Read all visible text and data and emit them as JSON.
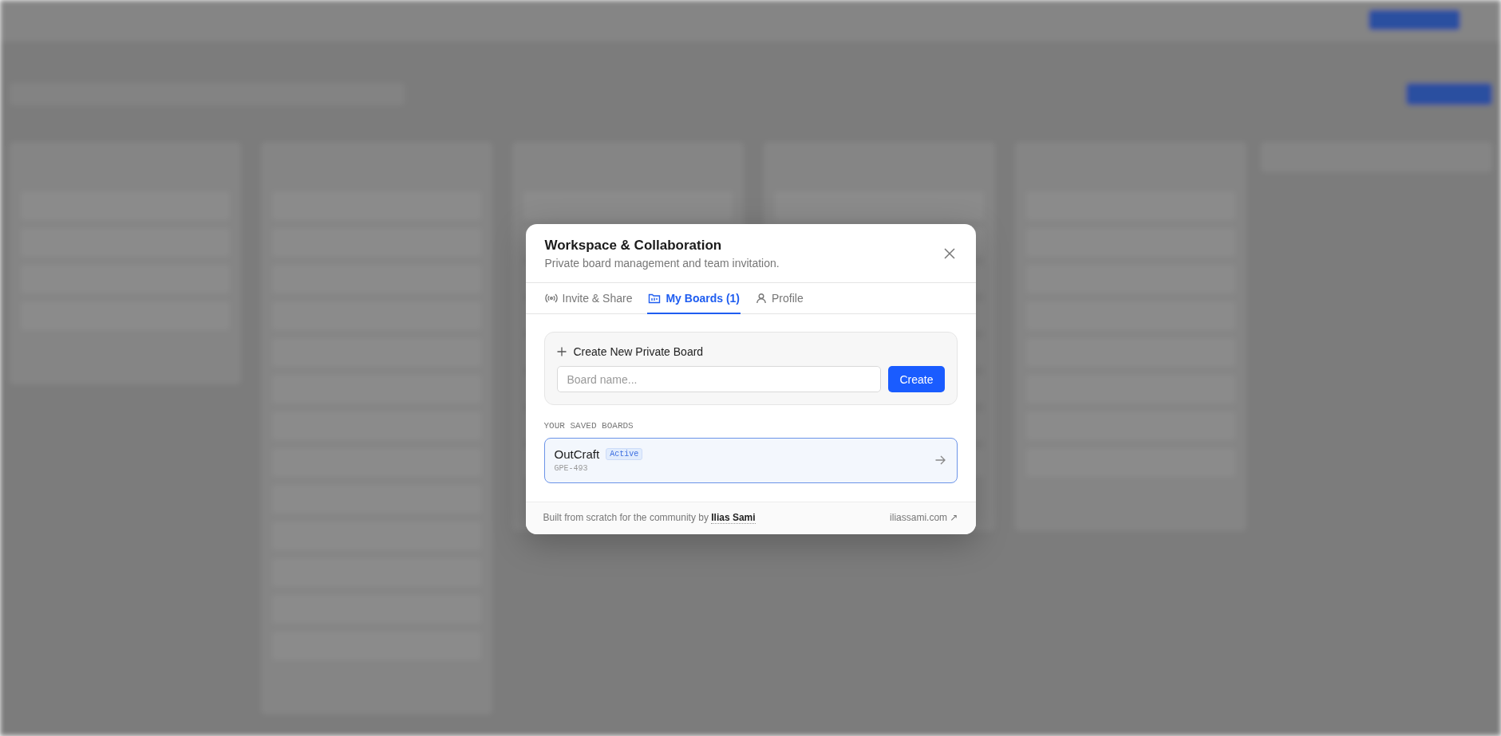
{
  "modal": {
    "title": "Workspace & Collaboration",
    "subtitle": "Private board management and team invitation.",
    "tabs": [
      {
        "label": "Invite & Share",
        "kind": "broadcast",
        "selected": false
      },
      {
        "label": "My Boards (1)",
        "kind": "boards",
        "selected": true
      },
      {
        "label": "Profile",
        "kind": "profile",
        "selected": false
      }
    ],
    "create_section": {
      "title": "Create New Private Board",
      "input": {
        "placeholder": "Board name..."
      },
      "button": "Create"
    },
    "saved_boards": {
      "heading": "YOUR SAVED BOARDS",
      "boards": [
        {
          "name": "OutCraft",
          "badge": "Active",
          "code": "GPE-493",
          "selected": true
        }
      ]
    },
    "footer": {
      "text": "Built from scratch for the community by",
      "author": "Ilias Sami",
      "link": "iliassami.com ↗"
    }
  }
}
